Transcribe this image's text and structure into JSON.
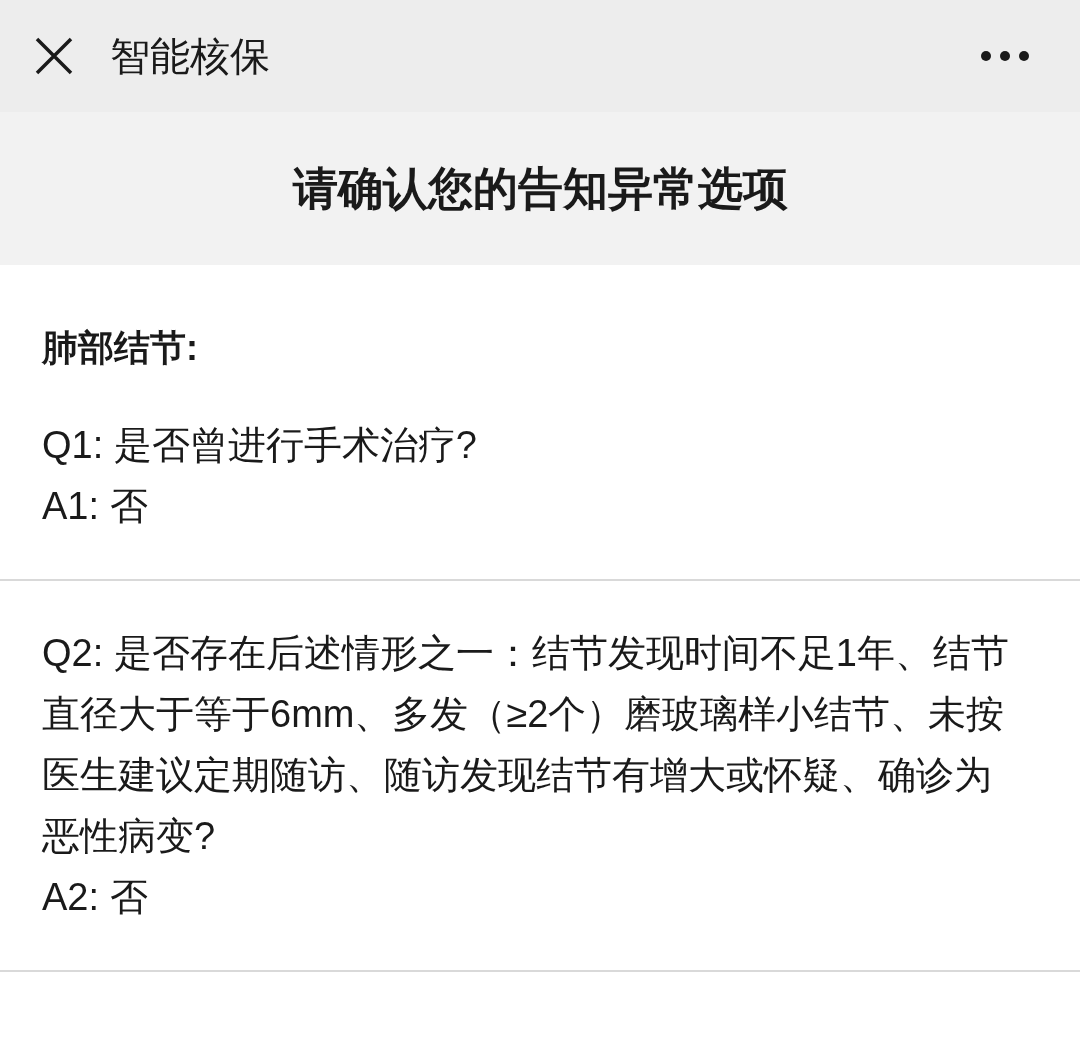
{
  "top_bar": {
    "title": "智能核保"
  },
  "header": {
    "title": "请确认您的告知异常选项"
  },
  "section": {
    "heading": "肺部结节:",
    "items": [
      {
        "question": "Q1: 是否曾进行手术治疗?",
        "answer": "A1: 否"
      },
      {
        "question": "Q2: 是否存在后述情形之一：结节发现时间不足1年、结节直径大于等于6mm、多发（≥2个）磨玻璃样小结节、未按医生建议定期随访、随访发现结节有增大或怀疑、确诊为恶性病变?",
        "answer": "A2: 否"
      }
    ]
  }
}
